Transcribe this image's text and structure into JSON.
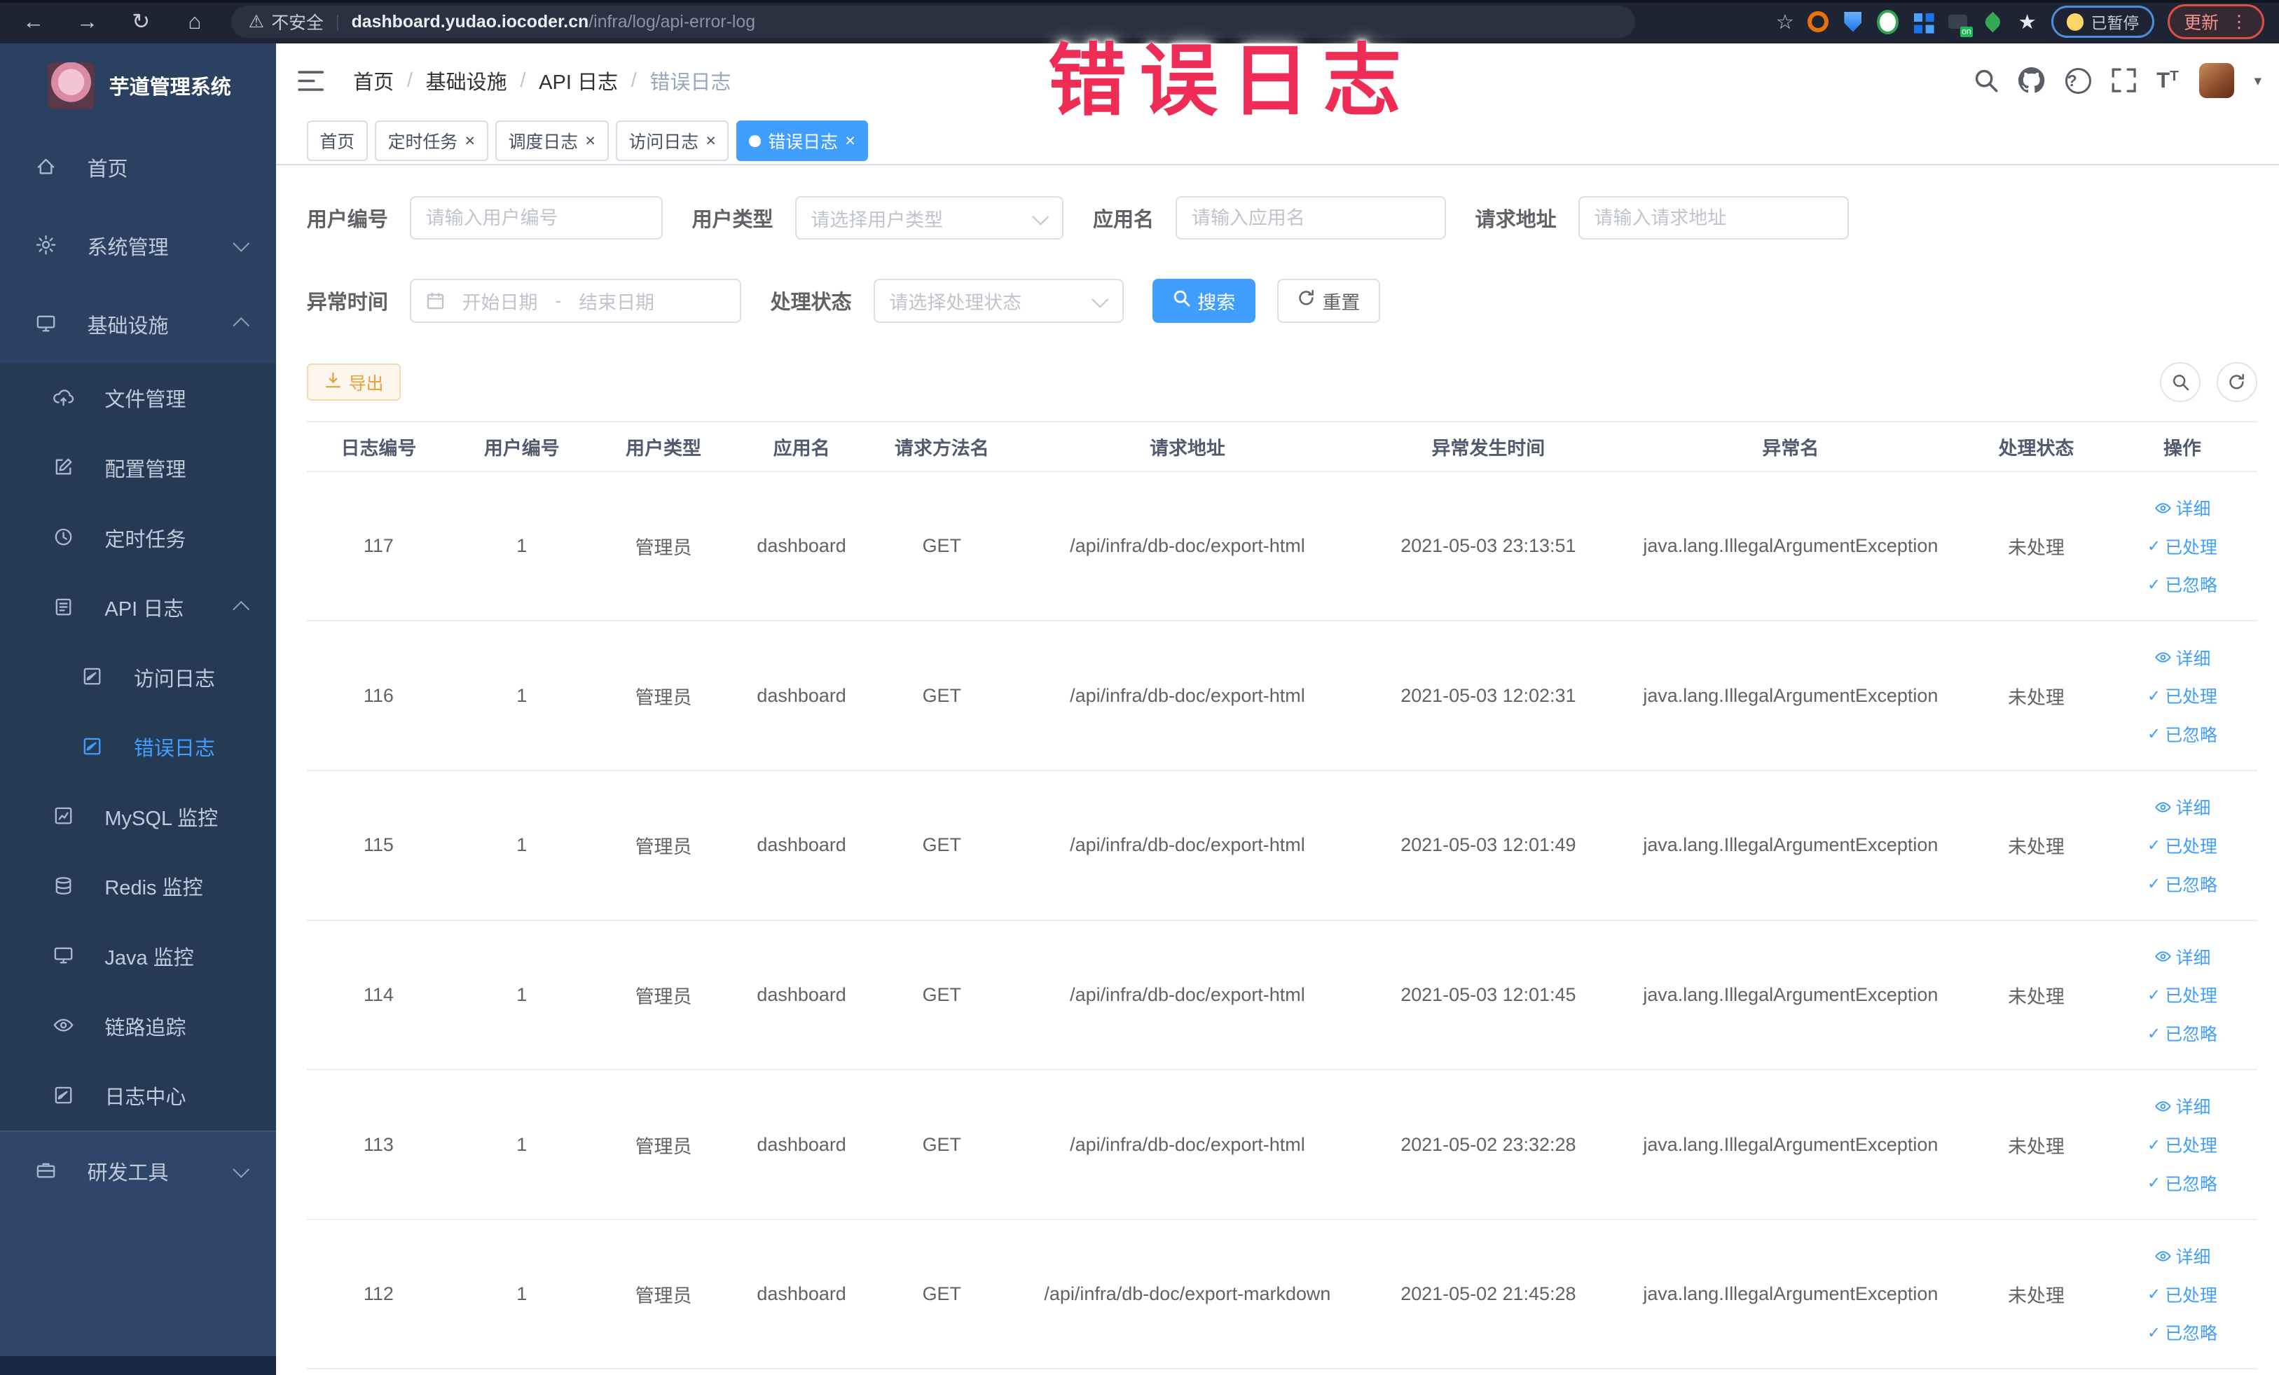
{
  "overlay_title": "错误日志",
  "browser": {
    "security_label": "不安全",
    "url_host": "dashboard.yudao.iocoder.cn",
    "url_path": "/infra/log/api-error-log",
    "paused_label": "已暂停",
    "update_label": "更新"
  },
  "sidebar": {
    "logo_title": "芋道管理系统",
    "sections": [
      {
        "name": "main",
        "items": [
          {
            "label": "首页",
            "icon": "home-icon"
          },
          {
            "label": "系统管理",
            "icon": "gear-icon",
            "chevron": "down"
          },
          {
            "label": "基础设施",
            "icon": "monitor-icon",
            "chevron": "up"
          }
        ]
      },
      {
        "name": "infra-submenu",
        "items": [
          {
            "label": "文件管理",
            "icon": "cloud-upload-icon",
            "indent": 1
          },
          {
            "label": "配置管理",
            "icon": "edit-icon",
            "indent": 1
          },
          {
            "label": "定时任务",
            "icon": "clock-icon",
            "indent": 1
          },
          {
            "label": "API 日志",
            "icon": "log-icon",
            "indent": 1,
            "chevron": "up"
          },
          {
            "label": "访问日志",
            "icon": "doc-edit-icon",
            "indent": 2
          },
          {
            "label": "错误日志",
            "icon": "doc-edit-icon",
            "indent": 2,
            "active": true
          },
          {
            "label": "MySQL 监控",
            "icon": "chart-icon",
            "indent": 1
          },
          {
            "label": "Redis 监控",
            "icon": "database-icon",
            "indent": 1
          },
          {
            "label": "Java 监控",
            "icon": "monitor-icon",
            "indent": 1
          },
          {
            "label": "链路追踪",
            "icon": "eye-icon",
            "indent": 1
          },
          {
            "label": "日志中心",
            "icon": "doc-edit-icon",
            "indent": 1
          }
        ]
      },
      {
        "name": "dev",
        "items": [
          {
            "label": "研发工具",
            "icon": "toolbox-icon",
            "chevron": "down"
          }
        ]
      }
    ]
  },
  "header": {
    "breadcrumb": [
      "首页",
      "基础设施",
      "API 日志",
      "错误日志"
    ]
  },
  "tabs": [
    {
      "label": "首页",
      "closable": false
    },
    {
      "label": "定时任务",
      "closable": true
    },
    {
      "label": "调度日志",
      "closable": true
    },
    {
      "label": "访问日志",
      "closable": true
    },
    {
      "label": "错误日志",
      "closable": true,
      "active": true
    }
  ],
  "filters": {
    "user_id": {
      "label": "用户编号",
      "placeholder": "请输入用户编号"
    },
    "user_type": {
      "label": "用户类型",
      "placeholder": "请选择用户类型"
    },
    "app_name": {
      "label": "应用名",
      "placeholder": "请输入应用名"
    },
    "request_url": {
      "label": "请求地址",
      "placeholder": "请输入请求地址"
    },
    "exception_time": {
      "label": "异常时间",
      "start_placeholder": "开始日期",
      "separator": "-",
      "end_placeholder": "结束日期"
    },
    "process_status": {
      "label": "处理状态",
      "placeholder": "请选择处理状态"
    },
    "search_label": "搜索",
    "reset_label": "重置"
  },
  "toolbar": {
    "export_label": "导出"
  },
  "table": {
    "columns": [
      "日志编号",
      "用户编号",
      "用户类型",
      "应用名",
      "请求方法名",
      "请求地址",
      "异常发生时间",
      "异常名",
      "处理状态",
      "操作"
    ],
    "actions": [
      "详细",
      "已处理",
      "已忽略"
    ],
    "rows": [
      {
        "id": "117",
        "user_id": "1",
        "user_type": "管理员",
        "app_name": "dashboard",
        "method": "GET",
        "url": "/api/infra/db-doc/export-html",
        "time": "2021-05-03 23:13:51",
        "exception": "java.lang.IllegalArgumentException",
        "status": "未处理"
      },
      {
        "id": "116",
        "user_id": "1",
        "user_type": "管理员",
        "app_name": "dashboard",
        "method": "GET",
        "url": "/api/infra/db-doc/export-html",
        "time": "2021-05-03 12:02:31",
        "exception": "java.lang.IllegalArgumentException",
        "status": "未处理"
      },
      {
        "id": "115",
        "user_id": "1",
        "user_type": "管理员",
        "app_name": "dashboard",
        "method": "GET",
        "url": "/api/infra/db-doc/export-html",
        "time": "2021-05-03 12:01:49",
        "exception": "java.lang.IllegalArgumentException",
        "status": "未处理"
      },
      {
        "id": "114",
        "user_id": "1",
        "user_type": "管理员",
        "app_name": "dashboard",
        "method": "GET",
        "url": "/api/infra/db-doc/export-html",
        "time": "2021-05-03 12:01:45",
        "exception": "java.lang.IllegalArgumentException",
        "status": "未处理"
      },
      {
        "id": "113",
        "user_id": "1",
        "user_type": "管理员",
        "app_name": "dashboard",
        "method": "GET",
        "url": "/api/infra/db-doc/export-html",
        "time": "2021-05-02 23:32:28",
        "exception": "java.lang.IllegalArgumentException",
        "status": "未处理"
      },
      {
        "id": "112",
        "user_id": "1",
        "user_type": "管理员",
        "app_name": "dashboard",
        "method": "GET",
        "url": "/api/infra/db-doc/export-markdown",
        "time": "2021-05-02 21:45:28",
        "exception": "java.lang.IllegalArgumentException",
        "status": "未处理"
      }
    ]
  },
  "colors": {
    "primary": "#409eff",
    "warning_text": "#e6a23c",
    "overlay_annotation": "#ee2c55",
    "sidebar_bg": "#2c4061",
    "submenu_bg": "#273a54"
  }
}
